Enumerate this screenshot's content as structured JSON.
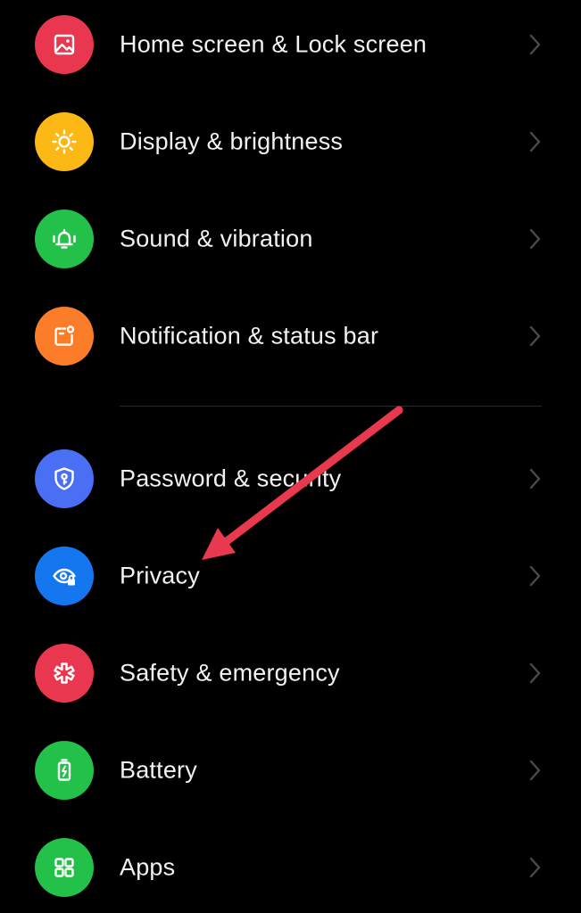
{
  "settings": {
    "items": [
      {
        "label": "Home screen & Lock screen",
        "icon": "image-icon",
        "color": "#e8374e"
      },
      {
        "label": "Display & brightness",
        "icon": "sun-icon",
        "color": "#fcb814"
      },
      {
        "label": "Sound & vibration",
        "icon": "bell-vibrate-icon",
        "color": "#23c04a"
      },
      {
        "label": "Notification & status bar",
        "icon": "notification-badge-icon",
        "color": "#fb7d2a"
      },
      {
        "label": "Password & security",
        "icon": "shield-key-icon",
        "color": "#4a6ef4"
      },
      {
        "label": "Privacy",
        "icon": "eye-lock-icon",
        "color": "#1577f0"
      },
      {
        "label": "Safety & emergency",
        "icon": "asterisk-icon",
        "color": "#e8374e"
      },
      {
        "label": "Battery",
        "icon": "battery-icon",
        "color": "#23c04a"
      },
      {
        "label": "Apps",
        "icon": "apps-grid-icon",
        "color": "#23c04a"
      }
    ]
  },
  "colors": {
    "background": "#000000",
    "text": "#f2f2f2",
    "chevron": "#4a4a4a",
    "divider": "#2a2a2a",
    "annotation_arrow": "#e8394f"
  },
  "annotation": {
    "icon": "red-arrow-annotation",
    "points_to": "Privacy"
  }
}
